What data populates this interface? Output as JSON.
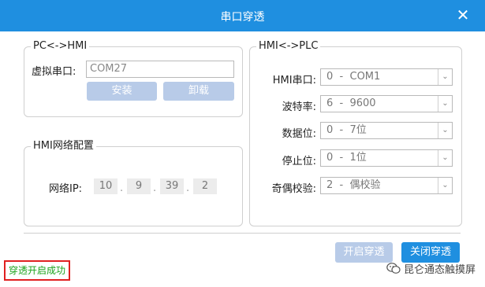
{
  "window": {
    "title": "串口穿透",
    "close_symbol": "✕"
  },
  "pc_hmi": {
    "legend": "PC<->HMI",
    "virtual_port_label": "虚拟串口:",
    "virtual_port_value": "COM27",
    "install_label": "安装",
    "uninstall_label": "卸载"
  },
  "hmi_network": {
    "legend": "HMI网络配置",
    "ip_label": "网络IP:",
    "ip": [
      "10",
      "9",
      "39",
      "2"
    ],
    "dot": "."
  },
  "hmi_plc": {
    "legend": "HMI<->PLC",
    "fields": [
      {
        "label": "HMI串口:",
        "value": "0  -  COM1"
      },
      {
        "label": "波特率:",
        "value": "6  -  9600"
      },
      {
        "label": "数据位:",
        "value": "0  -  7位"
      },
      {
        "label": "停止位:",
        "value": "0  -  1位"
      },
      {
        "label": "奇偶校验:",
        "value": "2  -  偶校验"
      }
    ]
  },
  "footer": {
    "open_label": "开启穿透",
    "close_label": "关闭穿透",
    "status_text": "穿透开启成功",
    "watermark_text": "昆仑通态触摸屏"
  },
  "colors": {
    "title_bar": "#1f8fe0",
    "primary": "#1f8fe0",
    "disabled": "#b8cbe8",
    "status_text": "#1aa21a",
    "status_border": "#e02020"
  }
}
